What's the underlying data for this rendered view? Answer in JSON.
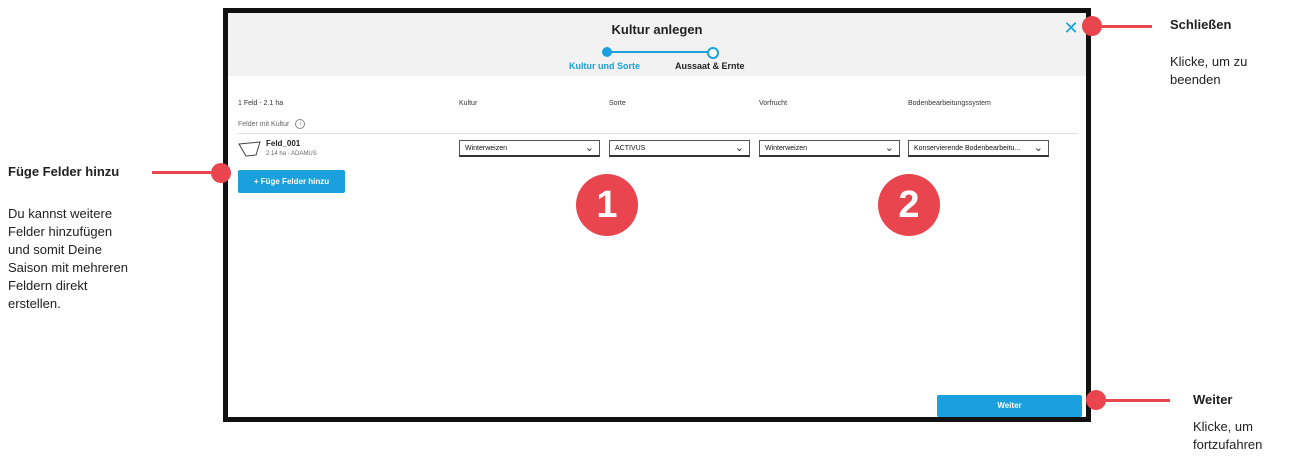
{
  "dialog": {
    "title": "Kultur anlegen",
    "close_icon": "close-icon",
    "steps": [
      {
        "label": "Kultur und Sorte",
        "active": true
      },
      {
        "label": "Aussaat & Ernte",
        "active": false
      }
    ],
    "columns": {
      "fields": "1 Feld - 2.1 ha",
      "crop": "Kultur",
      "variety": "Sorte",
      "previous_crop": "Vorfrucht",
      "tillage": "Bodenbearbeitungssystem"
    },
    "fields_with_crop": "Felder mit Kultur",
    "field": {
      "name": "Feld_001",
      "details": "2.14 ha - ADAMUS",
      "crop": "Winterweizen",
      "variety": "ACTIVUS",
      "previous_crop": "Winterweizen",
      "tillage": "Konservierende Bodenbearbeitu..."
    },
    "add_fields_button": "+ Füge Felder hinzu",
    "next_button": "Weiter"
  },
  "badges": [
    "1",
    "2"
  ],
  "annotations": {
    "close": {
      "title": "Schließen",
      "text_lines": [
        "Klicke, um zu",
        "beenden"
      ]
    },
    "add": {
      "title": "Füge Felder hinzu",
      "text_lines": [
        "Du kannst weitere",
        "Felder hinzufügen",
        "und somit Deine",
        "Saison mit mehreren",
        "Feldern direkt",
        "erstellen."
      ]
    },
    "next": {
      "title": "Weiter",
      "text_lines": [
        "Klicke, um",
        "fortzufahren"
      ]
    }
  },
  "colors": {
    "accent": "#1aa0dc",
    "callout": "#e8454e",
    "frame": "#111111",
    "header_bg": "#f2f2f2"
  }
}
